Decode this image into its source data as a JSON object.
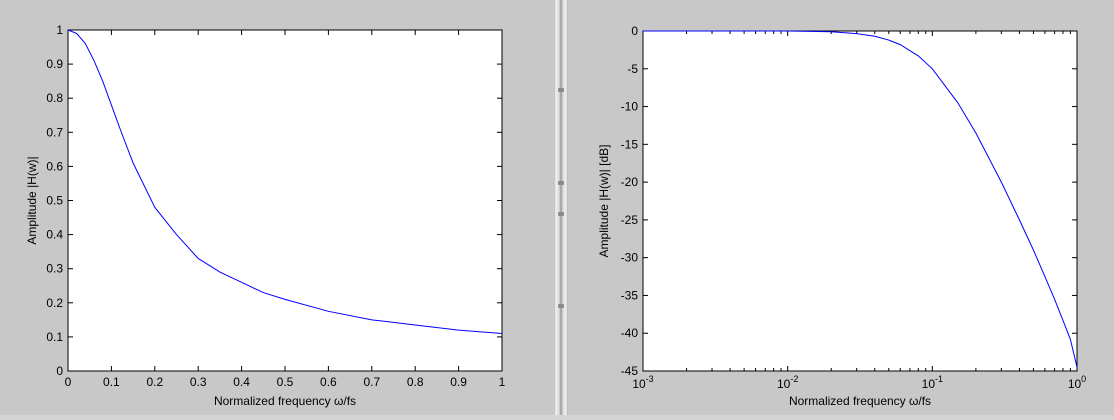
{
  "splitter": {
    "grip_icon": "splitter-grip-icon"
  },
  "chart_data": [
    {
      "type": "line",
      "xlabel": "Normalized frequency ω/fs",
      "ylabel": "Amplitude |H(w)|",
      "xlim": [
        0,
        1
      ],
      "ylim": [
        0,
        1
      ],
      "x_scale": "linear",
      "xticks": [
        0,
        0.1,
        0.2,
        0.3,
        0.4,
        0.5,
        0.6,
        0.7,
        0.8,
        0.9,
        1
      ],
      "xtick_labels": [
        "0",
        "0.1",
        "0.2",
        "0.3",
        "0.4",
        "0.5",
        "0.6",
        "0.7",
        "0.8",
        "0.9",
        "1"
      ],
      "yticks": [
        0,
        0.1,
        0.2,
        0.3,
        0.4,
        0.5,
        0.6,
        0.7,
        0.8,
        0.9,
        1
      ],
      "ytick_labels": [
        "0",
        "0.1",
        "0.2",
        "0.3",
        "0.4",
        "0.5",
        "0.6",
        "0.7",
        "0.8",
        "0.9",
        "1"
      ],
      "grid": false,
      "line_color": "#0000ff",
      "series": [
        {
          "x": [
            0,
            0.02,
            0.04,
            0.06,
            0.08,
            0.1,
            0.12,
            0.15,
            0.2,
            0.25,
            0.3,
            0.35,
            0.4,
            0.45,
            0.5,
            0.6,
            0.7,
            0.8,
            0.9,
            1.0
          ],
          "y": [
            1.0,
            0.99,
            0.96,
            0.91,
            0.85,
            0.78,
            0.71,
            0.61,
            0.48,
            0.4,
            0.33,
            0.29,
            0.26,
            0.23,
            0.21,
            0.175,
            0.15,
            0.135,
            0.12,
            0.11
          ]
        }
      ]
    },
    {
      "type": "line",
      "xlabel": "Normalized frequency ω/fs",
      "ylabel": "Amplitude |H(w)| [dB]",
      "xlim": [
        0.001,
        1
      ],
      "ylim": [
        -45,
        0
      ],
      "x_scale": "log",
      "xticks": [
        0.001,
        0.01,
        0.1,
        1
      ],
      "xtick_labels": [
        {
          "base": "10",
          "exp": "-3"
        },
        {
          "base": "10",
          "exp": "-2"
        },
        {
          "base": "10",
          "exp": "-1"
        },
        {
          "base": "10",
          "exp": "0"
        }
      ],
      "yticks": [
        0,
        -5,
        -10,
        -15,
        -20,
        -25,
        -30,
        -35,
        -40,
        -45
      ],
      "ytick_labels": [
        "0",
        "-5",
        "-10",
        "-15",
        "-20",
        "-25",
        "-30",
        "-35",
        "-40",
        "-45"
      ],
      "grid": false,
      "line_color": "#0000ff",
      "series": [
        {
          "x": [
            0.001,
            0.005,
            0.01,
            0.02,
            0.03,
            0.04,
            0.05,
            0.06,
            0.07,
            0.08,
            0.1,
            0.15,
            0.2,
            0.3,
            0.4,
            0.5,
            0.6,
            0.7,
            0.8,
            0.9,
            1.0
          ],
          "y": [
            0,
            0,
            0,
            -0.1,
            -0.35,
            -0.7,
            -1.2,
            -1.8,
            -2.6,
            -3.3,
            -5.0,
            -9.5,
            -13.5,
            -20.0,
            -25.0,
            -29.0,
            -32.5,
            -35.5,
            -38.3,
            -40.8,
            -44.5
          ]
        }
      ]
    }
  ]
}
